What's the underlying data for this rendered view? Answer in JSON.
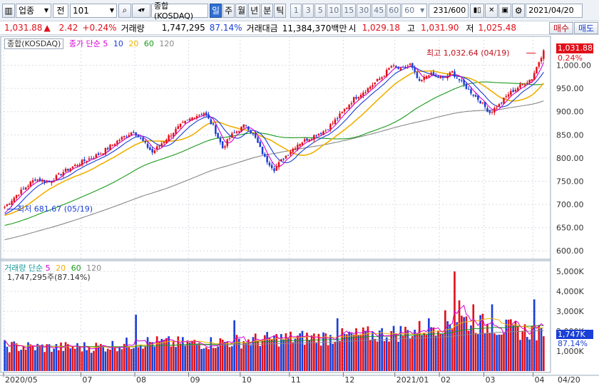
{
  "toolbar": {
    "market": "업종",
    "mode": "전",
    "code": "101",
    "name": "종합(KOSDAQ)",
    "periods": [
      "일",
      "주",
      "월",
      "년",
      "분",
      "틱"
    ],
    "active_period": "일",
    "minute_options": [
      "1",
      "3",
      "5",
      "10",
      "15",
      "30",
      "45",
      "60"
    ],
    "selected_minute": "60",
    "count": "231",
    "count_total": "/600",
    "date": "2021/04/20"
  },
  "quote": {
    "price": "1,031.88",
    "change": "2.42",
    "change_pct": "+0.24%",
    "volume_label": "거래량",
    "volume": "1,747,295",
    "volume_pct": "87.14%",
    "amount_label": "거래대금",
    "amount": "11,384,370백만",
    "open_label": "시",
    "open": "1,029.18",
    "high_label": "고",
    "high": "1,031.90",
    "low_label": "저",
    "low": "1,025.48",
    "buy_label": "매수",
    "sell_label": "매도"
  },
  "colors": {
    "up": "#e0101a",
    "down": "#1a3fd6",
    "ma5": "#d400d4",
    "ma10": "#1a3fd6",
    "ma20": "#f0b000",
    "ma60": "#1a9a1a",
    "ma120": "#888888"
  },
  "price_panel": {
    "name": "종합(KOSDAQ)",
    "legend_title": "종가 단순",
    "ma_periods": [
      "5",
      "10",
      "20",
      "60",
      "120"
    ],
    "high_label": "최고 1,032.64 (04/19)",
    "low_label": "최저 681.67 (05/19)",
    "current_price": "1,031.88",
    "current_pct": "0.24%"
  },
  "volume_panel": {
    "legend_title": "거래량 단순",
    "ma_periods": [
      "5",
      "20",
      "60",
      "120"
    ],
    "current_text": "1,747,295주(87.14%)",
    "current_label": "1,747K",
    "current_pct": "87.14%"
  },
  "chart_data": [
    {
      "type": "candlestick",
      "title": "종합(KOSDAQ)",
      "ylim": [
        585,
        1050
      ],
      "yticks": [
        "1,000.00",
        "950.00",
        "900.00",
        "850.00",
        "800.00",
        "750.00",
        "700.00",
        "650.00",
        "600.00"
      ],
      "ytick_values": [
        1000,
        950,
        900,
        850,
        800,
        750,
        700,
        650,
        600
      ],
      "x_months": [
        "2020/05",
        "07",
        "08",
        "09",
        "10",
        "11",
        "12",
        "2021/01",
        "02",
        "03",
        "04"
      ],
      "anchors": [
        {
          "t": 0,
          "v": 690
        },
        {
          "t": 6,
          "v": 720
        },
        {
          "t": 14,
          "v": 755
        },
        {
          "t": 20,
          "v": 748
        },
        {
          "t": 26,
          "v": 770
        },
        {
          "t": 34,
          "v": 792
        },
        {
          "t": 42,
          "v": 810
        },
        {
          "t": 50,
          "v": 840
        },
        {
          "t": 56,
          "v": 858
        },
        {
          "t": 60,
          "v": 835
        },
        {
          "t": 64,
          "v": 812
        },
        {
          "t": 70,
          "v": 842
        },
        {
          "t": 76,
          "v": 870
        },
        {
          "t": 82,
          "v": 890
        },
        {
          "t": 86,
          "v": 898
        },
        {
          "t": 90,
          "v": 868
        },
        {
          "t": 94,
          "v": 822
        },
        {
          "t": 98,
          "v": 850
        },
        {
          "t": 104,
          "v": 872
        },
        {
          "t": 108,
          "v": 842
        },
        {
          "t": 112,
          "v": 800
        },
        {
          "t": 116,
          "v": 776
        },
        {
          "t": 120,
          "v": 800
        },
        {
          "t": 126,
          "v": 830
        },
        {
          "t": 132,
          "v": 846
        },
        {
          "t": 138,
          "v": 860
        },
        {
          "t": 144,
          "v": 892
        },
        {
          "t": 150,
          "v": 928
        },
        {
          "t": 156,
          "v": 950
        },
        {
          "t": 162,
          "v": 975
        },
        {
          "t": 166,
          "v": 998
        },
        {
          "t": 170,
          "v": 990
        },
        {
          "t": 174,
          "v": 1002
        },
        {
          "t": 178,
          "v": 962
        },
        {
          "t": 182,
          "v": 982
        },
        {
          "t": 188,
          "v": 970
        },
        {
          "t": 192,
          "v": 985
        },
        {
          "t": 196,
          "v": 962
        },
        {
          "t": 200,
          "v": 942
        },
        {
          "t": 204,
          "v": 922
        },
        {
          "t": 208,
          "v": 898
        },
        {
          "t": 212,
          "v": 915
        },
        {
          "t": 216,
          "v": 938
        },
        {
          "t": 220,
          "v": 952
        },
        {
          "t": 226,
          "v": 972
        },
        {
          "t": 231,
          "v": 1031.88
        }
      ],
      "moving_averages": [
        "5",
        "10",
        "20",
        "60",
        "120"
      ]
    },
    {
      "type": "bar",
      "title": "거래량",
      "ylim": [
        0,
        5400
      ],
      "yticks": [
        "5,000K",
        "4,000K",
        "3,000K",
        "2,000K",
        "1,000K"
      ],
      "ytick_values": [
        5000,
        4000,
        3000,
        2000,
        1000
      ],
      "anchors": [
        {
          "t": 0,
          "v": 1250
        },
        {
          "t": 20,
          "v": 1180
        },
        {
          "t": 40,
          "v": 1220
        },
        {
          "t": 60,
          "v": 1450
        },
        {
          "t": 80,
          "v": 1380
        },
        {
          "t": 100,
          "v": 1500
        },
        {
          "t": 120,
          "v": 1650
        },
        {
          "t": 140,
          "v": 1700
        },
        {
          "t": 160,
          "v": 1850
        },
        {
          "t": 175,
          "v": 2000
        },
        {
          "t": 185,
          "v": 2400
        },
        {
          "t": 195,
          "v": 2600
        },
        {
          "t": 205,
          "v": 2300
        },
        {
          "t": 215,
          "v": 2100
        },
        {
          "t": 225,
          "v": 2000
        },
        {
          "t": 231,
          "v": 1747
        }
      ],
      "spikes": [
        {
          "t": 56,
          "v": 2830
        },
        {
          "t": 98,
          "v": 2550
        },
        {
          "t": 142,
          "v": 2650
        },
        {
          "t": 192,
          "v": 5000
        },
        {
          "t": 194,
          "v": 3550
        },
        {
          "t": 200,
          "v": 3350
        },
        {
          "t": 208,
          "v": 3350
        },
        {
          "t": 226,
          "v": 3600
        }
      ]
    }
  ]
}
